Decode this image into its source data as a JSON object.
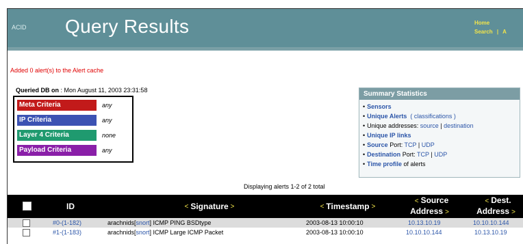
{
  "header": {
    "brand": "ACID",
    "title": "Query Results",
    "links": {
      "home": "Home",
      "search": "Search",
      "sep": "|",
      "more": "A"
    }
  },
  "alert_message": "Added 0 alert(s) to the Alert cache",
  "queried": {
    "label": "Queried DB on",
    "value": " : Mon August 11, 2003 23:31:58"
  },
  "criteria": [
    {
      "label": "Meta Criteria",
      "value": "any",
      "color": "#c21a1a"
    },
    {
      "label": "IP Criteria",
      "value": "any",
      "color": "#3c52b3"
    },
    {
      "label": "Layer 4 Criteria",
      "value": "none",
      "color": "#1f9a6f"
    },
    {
      "label": "Payload Criteria",
      "value": "any",
      "color": "#8a1fa8"
    }
  ],
  "summary": {
    "title": "Summary Statistics",
    "sensors": "Sensors",
    "unique_alerts": "Unique Alerts",
    "classifications": "( classifications )",
    "unique_addresses": "Unique addresses:",
    "source": "source",
    "pipe": "|",
    "destination": "destination",
    "unique_ip_links": "Unique IP links",
    "source_port_label": "Source",
    "port_word": "Port:",
    "tcp": "TCP",
    "udp": "UDP",
    "destination_port_label": "Destination",
    "time_profile": "Time profile",
    "of_alerts": "of alerts"
  },
  "displaying": "Displaying alerts 1-2 of 2 total",
  "table": {
    "headers": {
      "id": "ID",
      "signature": "Signature",
      "timestamp": "Timestamp",
      "source_line1": "Source",
      "source_line2": "Address",
      "dest_line1": "Dest.",
      "dest_line2": "Address",
      "arrow_left": "<",
      "arrow_right": ">"
    },
    "rows": [
      {
        "id": "#0-(1-182)",
        "sig_prefix": "arachnids[",
        "sig_snort": "snort",
        "sig_suffix": "] ICMP PING BSDtype",
        "timestamp": "2003-08-13 10:00:10",
        "src": "10.13.10.19",
        "dst": "10.10.10.144"
      },
      {
        "id": "#1-(1-183)",
        "sig_prefix": "arachnids[",
        "sig_snort": "snort",
        "sig_suffix": "] ICMP Large ICMP Packet",
        "timestamp": "2003-08-13 10:00:10",
        "src": "10.10.10.144",
        "dst": "10.13.10.19"
      }
    ]
  }
}
